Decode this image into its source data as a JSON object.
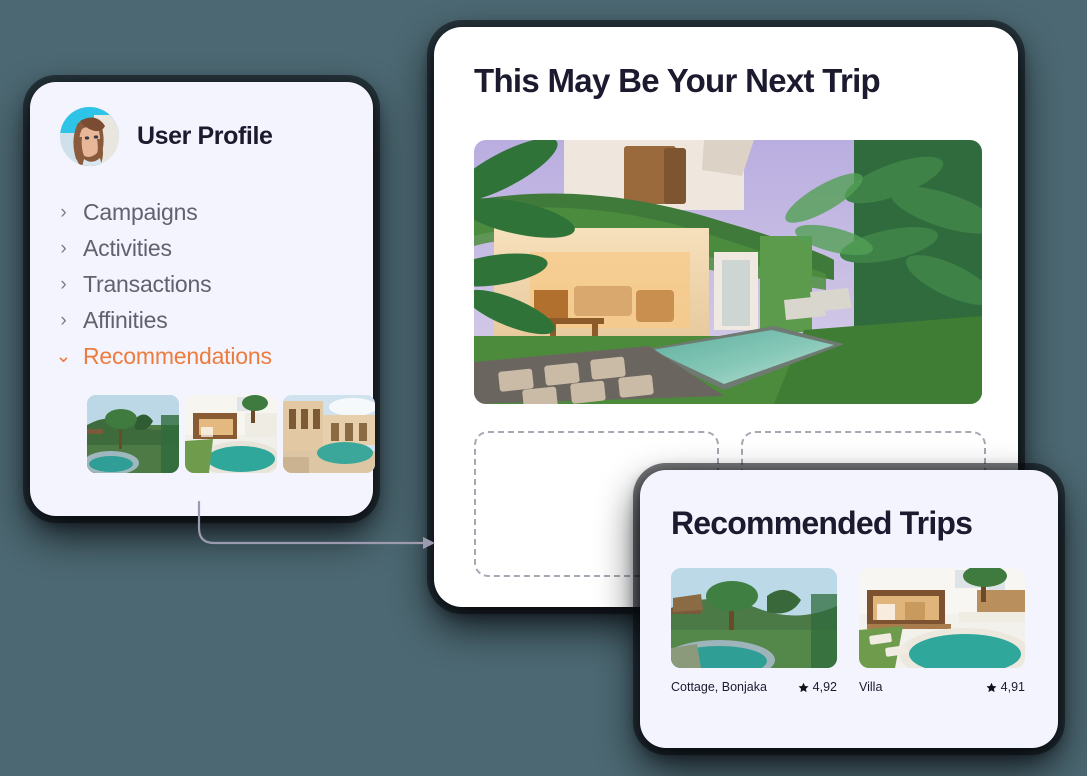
{
  "theme": {
    "page_background": "#4C6872",
    "card_background": "#FFFFFF",
    "panel_background": "#F4F4FE",
    "accent_orange": "#EC7C3D",
    "text_dark": "#1C1A2E",
    "text_muted": "#61616F",
    "placeholder_border": "#A7A7B4"
  },
  "sidebar": {
    "avatar": "user-avatar-photo",
    "title": "User Profile",
    "items": [
      {
        "label": "Campaigns",
        "icon": "chevron-right-icon",
        "active": false
      },
      {
        "label": "Activities",
        "icon": "chevron-right-icon",
        "active": false
      },
      {
        "label": "Transactions",
        "icon": "chevron-right-icon",
        "active": false
      },
      {
        "label": "Affinities",
        "icon": "chevron-right-icon",
        "active": false
      },
      {
        "label": "Recommendations",
        "icon": "chevron-down-icon",
        "active": true
      }
    ],
    "thumbnails": [
      {
        "name": "jungle-infinity-pool-thumbnail"
      },
      {
        "name": "modern-villa-pool-thumbnail"
      },
      {
        "name": "adobe-house-pool-thumbnail"
      }
    ]
  },
  "main": {
    "title": "This May Be Your Next Trip",
    "hero_image": "tropical-villa-pool-at-dusk",
    "placeholders": [
      {
        "name": "empty-trip-slot-1"
      },
      {
        "name": "empty-trip-slot-2"
      }
    ]
  },
  "recommended": {
    "title": "Recommended Trips",
    "trips": [
      {
        "name": "Cottage, Bonjaka",
        "rating": "4,92",
        "rating_icon": "star-icon",
        "image": "jungle-infinity-pool"
      },
      {
        "name": "Villa",
        "rating": "4,91",
        "rating_icon": "star-icon",
        "image": "modern-villa-pool"
      }
    ]
  },
  "connector": {
    "name": "flow-arrow",
    "from": "sidebar-recommendations",
    "to": "main-panel"
  }
}
